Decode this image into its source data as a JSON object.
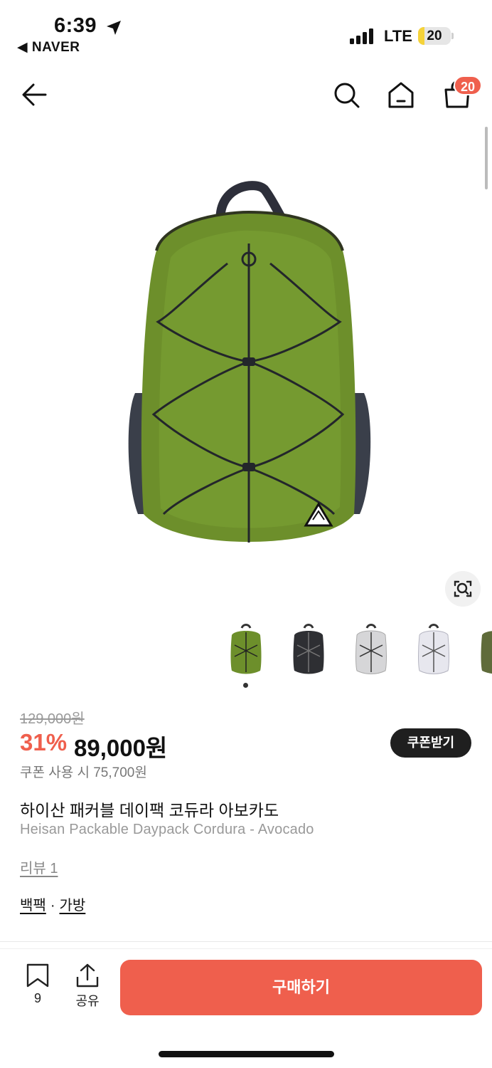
{
  "status_bar": {
    "time": "6:39",
    "back_app": "◀ NAVER",
    "network": "LTE",
    "battery": "20",
    "battery_level": 0.2
  },
  "header": {
    "icons": [
      "back-arrow-icon",
      "search-icon",
      "home-icon",
      "cart-icon"
    ],
    "cart_count": "20"
  },
  "gallery": {
    "thumbnails": [
      {
        "name": "green",
        "color": "#6e8f2c"
      },
      {
        "name": "black",
        "color": "#2e2f33"
      },
      {
        "name": "light-gray",
        "color": "#d6d6d8"
      },
      {
        "name": "white",
        "color": "#e7e7ee"
      },
      {
        "name": "olive-partial",
        "color": "#5f6b3a"
      }
    ],
    "active_index": 0
  },
  "product": {
    "original_price": "129,000원",
    "discount": "31%",
    "price": "89,000원",
    "coupon_button": "쿠폰받기",
    "coupon_price": "쿠폰 사용 시 75,700원",
    "name_ko": "하이산 패커블 데이팩 코듀라 아보카도",
    "name_en": "Heisan Packable Daypack Cordura - Avocado",
    "review_link": "리뷰 1",
    "categories": [
      "백팩",
      "가방"
    ],
    "category_separator": "·"
  },
  "bottom_bar": {
    "wish_count": "9",
    "share_label": "공유",
    "buy_label": "구매하기"
  },
  "colors": {
    "accent": "#ef5f4d",
    "badge_dark": "#1f1f1f"
  }
}
